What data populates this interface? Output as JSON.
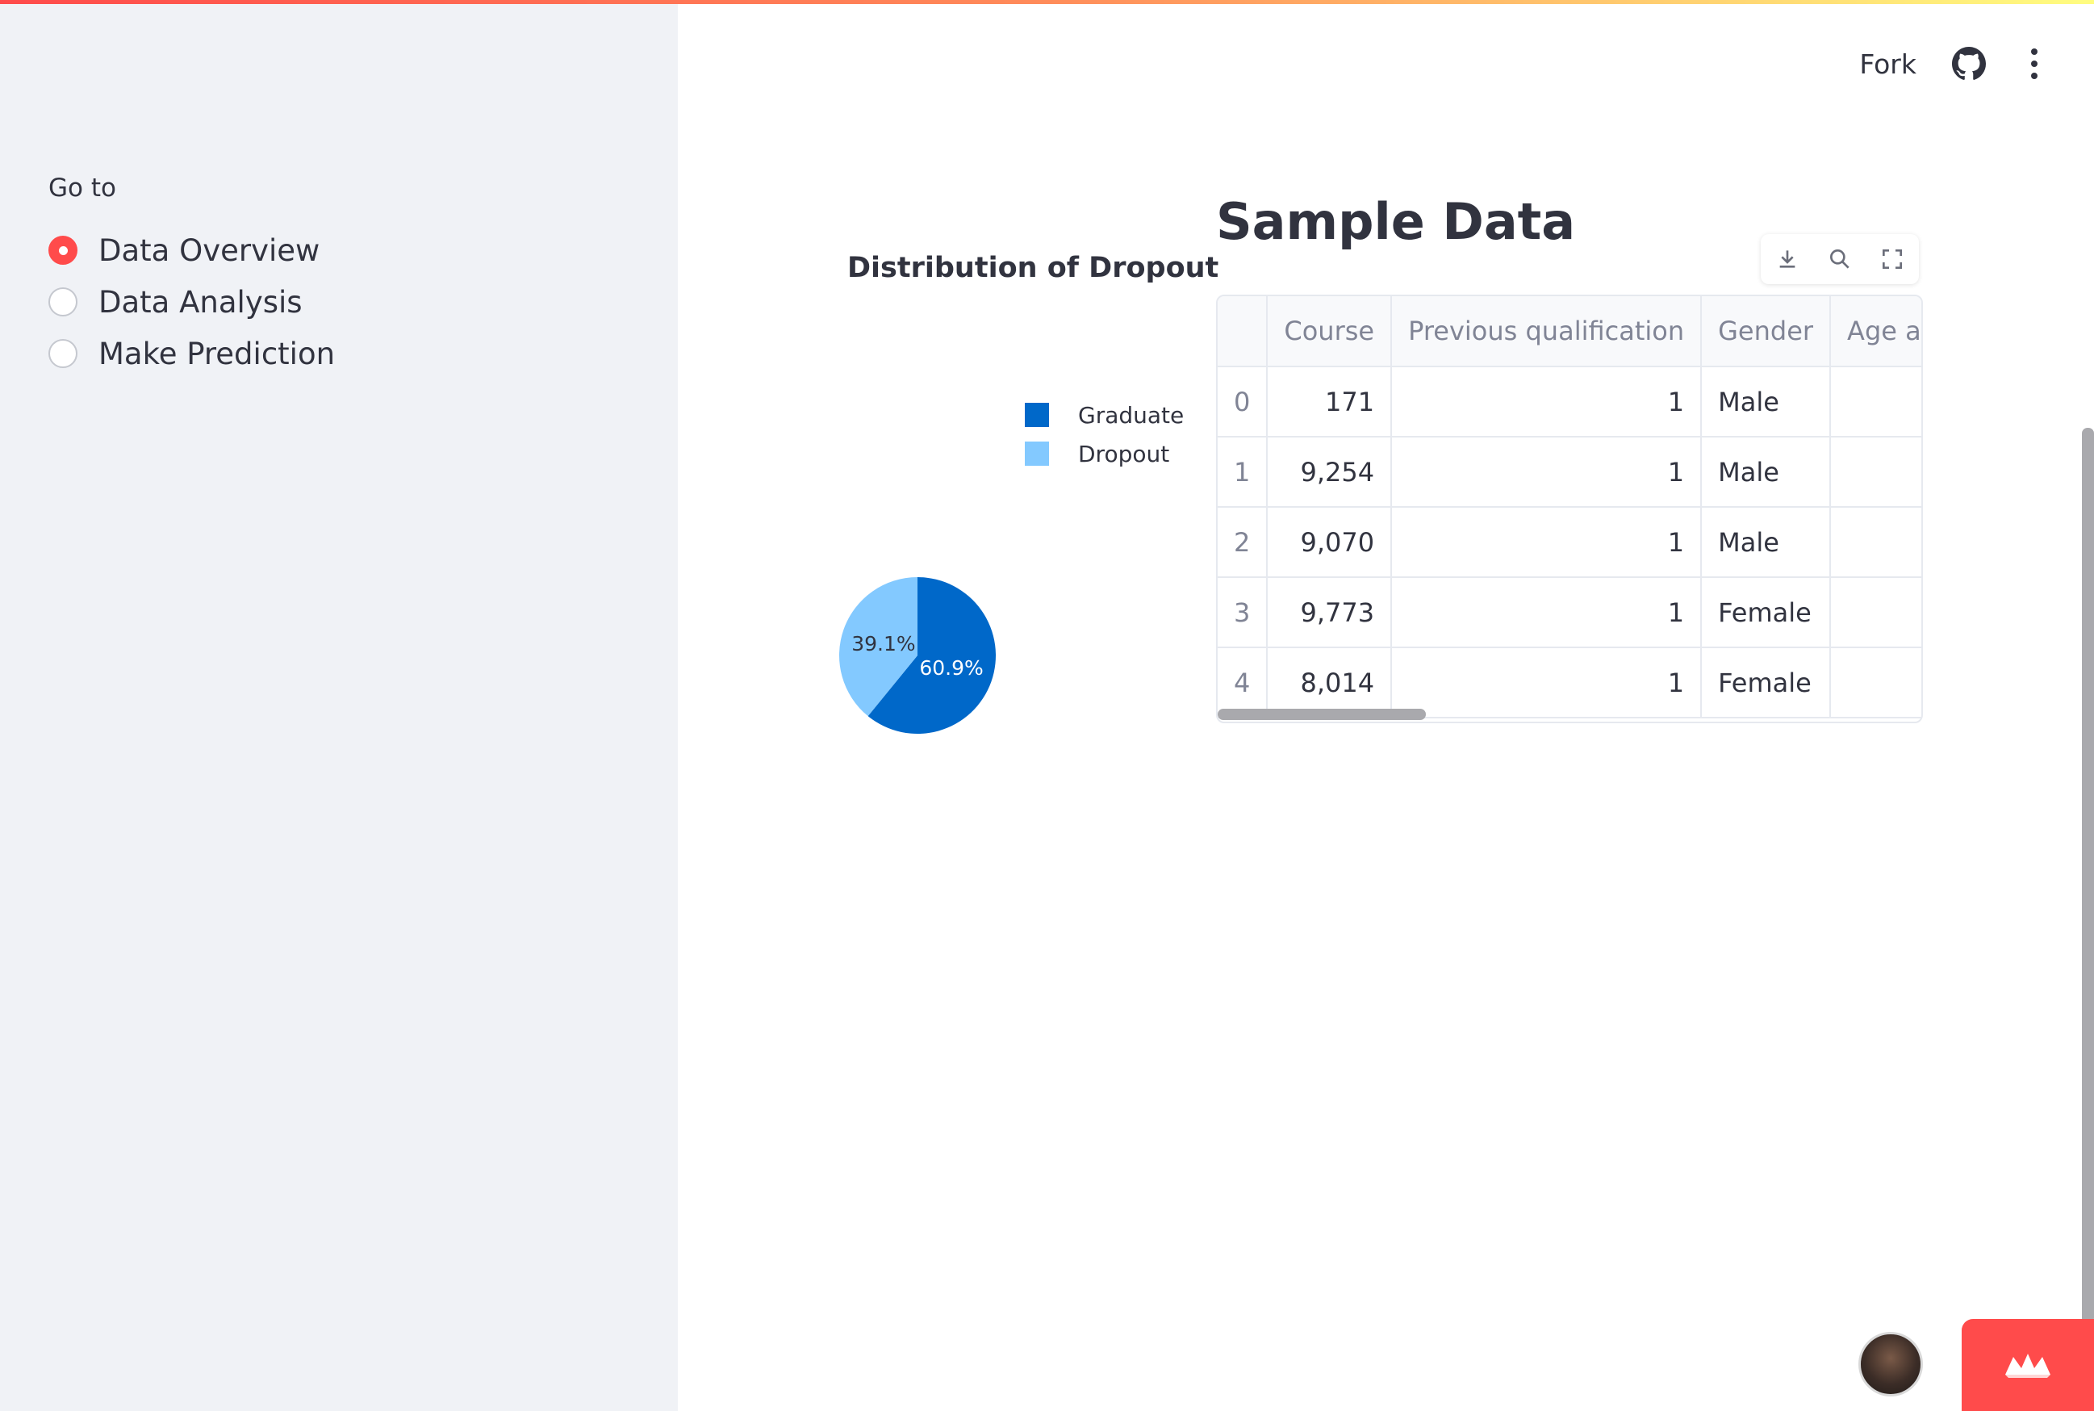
{
  "header": {
    "fork_label": "Fork"
  },
  "sidebar": {
    "label": "Go to",
    "options": [
      {
        "label": "Data Overview",
        "selected": true
      },
      {
        "label": "Data Analysis",
        "selected": false
      },
      {
        "label": "Make Prediction",
        "selected": false
      }
    ]
  },
  "chart_data": {
    "type": "pie",
    "title": "Distribution of Dropout",
    "categories": [
      "Graduate",
      "Dropout"
    ],
    "values": [
      60.9,
      39.1
    ],
    "value_labels": [
      "60.9%",
      "39.1%"
    ],
    "colors": [
      "#0068c9",
      "#83c9ff"
    ],
    "legend_position": "top-right"
  },
  "main": {
    "title": "Sample Data",
    "table": {
      "columns": [
        "",
        "Course",
        "Previous qualification",
        "Gender",
        "Age a"
      ],
      "rows": [
        [
          "0",
          "171",
          "1",
          "Male",
          ""
        ],
        [
          "1",
          "9,254",
          "1",
          "Male",
          ""
        ],
        [
          "2",
          "9,070",
          "1",
          "Male",
          ""
        ],
        [
          "3",
          "9,773",
          "1",
          "Female",
          ""
        ],
        [
          "4",
          "8,014",
          "1",
          "Female",
          ""
        ]
      ]
    }
  }
}
